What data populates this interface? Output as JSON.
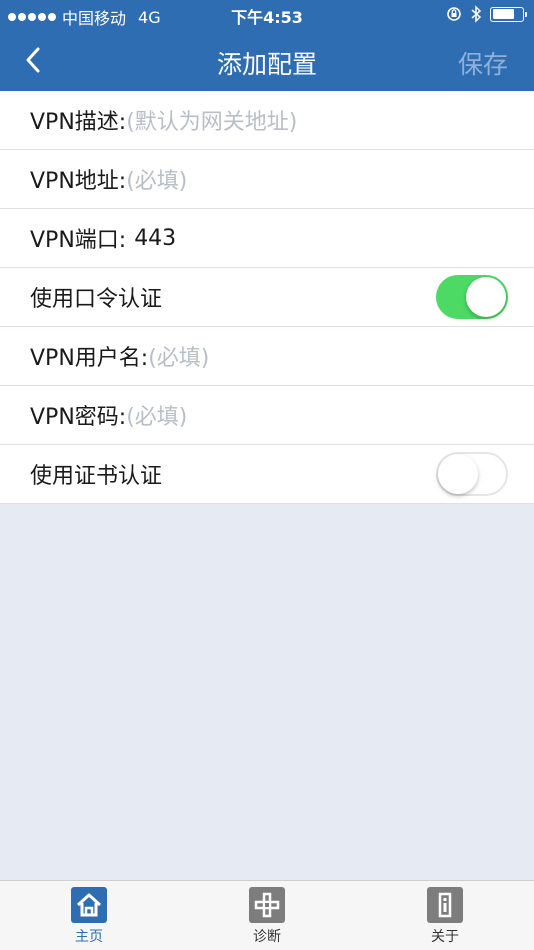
{
  "status_bar": {
    "carrier": "中国移动",
    "network": "4G",
    "time": "下午4:53",
    "battery_level": 0.75
  },
  "nav": {
    "back_icon": "chevron-left-icon",
    "title": "添加配置",
    "save_label": "保存"
  },
  "form": {
    "rows": [
      {
        "label": "VPN描述:",
        "placeholder": "(默认为网关地址)"
      },
      {
        "label": "VPN地址:",
        "placeholder": "(必填)"
      },
      {
        "label": "VPN端口:",
        "value": "443"
      },
      {
        "label": "使用口令认证",
        "toggle": true
      },
      {
        "label": "VPN用户名:",
        "placeholder": "(必填)"
      },
      {
        "label": "VPN密码:",
        "placeholder": "(必填)"
      },
      {
        "label": "使用证书认证",
        "toggle": false
      }
    ]
  },
  "tabbar": {
    "tabs": [
      {
        "label": "主页",
        "icon": "home-icon",
        "active": true
      },
      {
        "label": "诊断",
        "icon": "diagnose-icon",
        "active": false
      },
      {
        "label": "关于",
        "icon": "about-icon",
        "active": false
      }
    ]
  },
  "colors": {
    "primary": "#2f6db3",
    "toggle_on": "#4cd964",
    "placeholder": "#b9bec7",
    "background": "#e6ebf3"
  }
}
